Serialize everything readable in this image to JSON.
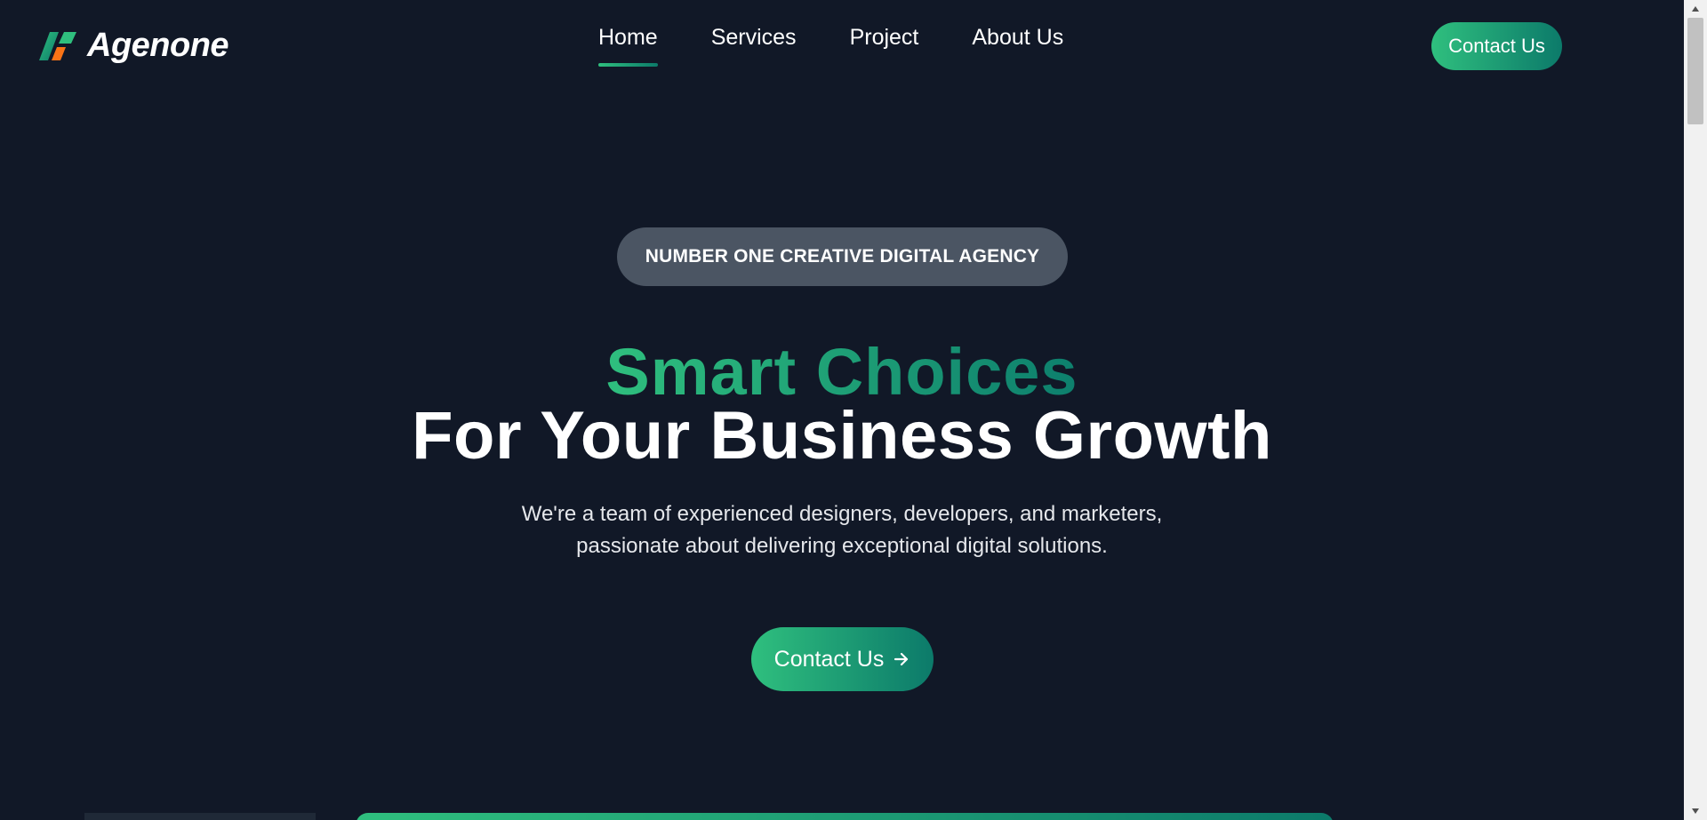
{
  "brand": {
    "name": "Agenone"
  },
  "nav": {
    "items": [
      {
        "label": "Home",
        "active": true
      },
      {
        "label": "Services",
        "active": false
      },
      {
        "label": "Project",
        "active": false
      },
      {
        "label": "About Us",
        "active": false
      }
    ]
  },
  "header": {
    "cta_label": "Contact Us"
  },
  "hero": {
    "badge": "NUMBER ONE CREATIVE DIGITAL AGENCY",
    "headline_accent": "Smart Choices",
    "headline_main": "For Your Business Growth",
    "description_line1": "We're a team of experienced designers, developers, and marketers,",
    "description_line2": "passionate about delivering exceptional digital solutions.",
    "cta_label": "Contact Us",
    "cta_icon": "arrow-right-icon"
  },
  "colors": {
    "background": "#111827",
    "accent_start": "#2fbf7e",
    "accent_end": "#0c7a6a",
    "badge_bg": "#4b5563",
    "logo_orange": "#f97316"
  }
}
